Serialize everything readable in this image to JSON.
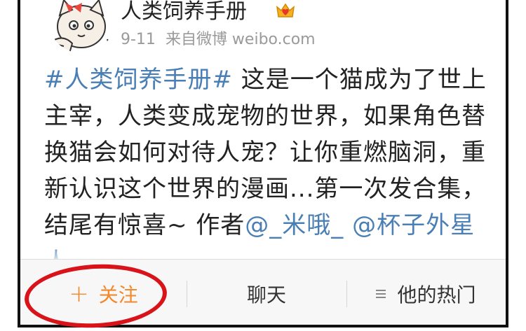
{
  "post": {
    "username": "人类饲养手册",
    "date": "9-11",
    "source": "来自微博 weibo.com",
    "hashtag": "#人类饲养手册#",
    "body_text": " 这是一个猫成为了世上主宰，人类变成宠物的世界，如果角色替换猫会如何对待人宠？让你重燃脑洞，重新认识这个世界的漫画...第一次发合集，结尾有惊喜~ 作者",
    "mention_text": "@_米哦_ @杯子外星人"
  },
  "toolbar": {
    "follow_plus": "+",
    "follow_label": "关注",
    "chat_label": "聊天",
    "hot_label": "他的热门"
  },
  "colors": {
    "link": "#4a7fb6",
    "follow": "#f28a2b",
    "highlight_circle": "#d8131a"
  },
  "icons": {
    "vip": "crown-heart-icon",
    "menu": "menu-lines-icon"
  }
}
